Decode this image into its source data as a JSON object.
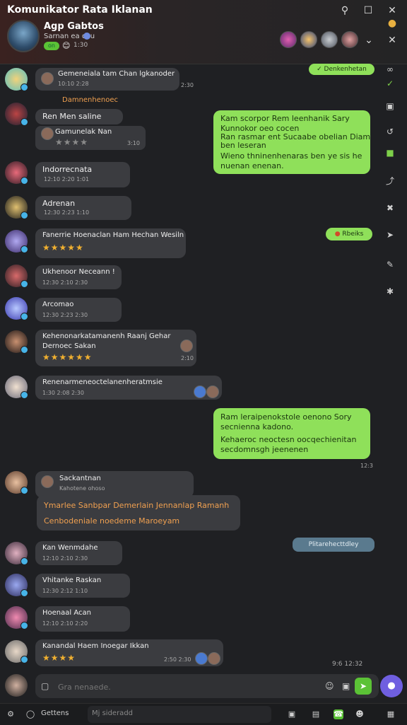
{
  "window": {
    "title": "Komunikator Rata Iklanan"
  },
  "chat": {
    "name": "Agp Gabtos",
    "subtitle": "Sarnan ea dcu",
    "count": "1:30",
    "status_badge": "on"
  },
  "outgoing": {
    "pill_1": "Denkenhetan",
    "msg_1": [
      "Kam scorpor Rem leenhanik Sary",
      "Kunnokor oeo cocen",
      "Ran rasmar ent Sucaabe obelian Diam",
      "ben leseran",
      "Wieno thninenhenaras ben ye sis he",
      "nuenan enenan."
    ],
    "pill_2": "Rbeiks",
    "msg_2": [
      "Ram leraipenokstole oenono Sory",
      "secnienna kadono.",
      "Kehaeroc neoctesn oocqechienitan",
      "secdomnsgh jeenenen"
    ],
    "msg_2_time": "12:3",
    "pill_3": "Plitarehecttdley",
    "last_time": "9:6  12:32"
  },
  "messages": [
    {
      "quote_name": "Gemeneiala tam Chan lgkanoder",
      "quote_meta": "10:10 2:28",
      "time": "2:30",
      "extra": "Damnenhenoec"
    },
    {
      "name": "Ren Men saline",
      "quote_name": "Gamunelak Nan",
      "quote_meta": "2:30",
      "stars": "★★★★",
      "time": "3:10"
    },
    {
      "name": "Indorrecnata",
      "meta": "12:10 2:20  1:01"
    },
    {
      "name": "Adrenan",
      "meta": "12:30 2:23  1:10"
    },
    {
      "name": "Fanerrie Hoenaclan Ham Hechan Wesiln",
      "stars": "★★★★★"
    },
    {
      "name": "Ukhenoor Neceann !",
      "meta": "12:30 2:10 2:30"
    },
    {
      "name": "Arcomao",
      "meta": "12:30 2:23  2:30"
    },
    {
      "name": "Kehenonarkatamanenh Raanj Gehar",
      "name2": "Dernoec Sakan",
      "stars": "★★★★★★",
      "time": "2:10"
    },
    {
      "name": "Renenarmeneoctelanenheratmsie",
      "meta": "1:30 2:08 2:30"
    },
    {
      "name": "Sackantnan",
      "meta": "Kahotene ohoso",
      "orange_1": "Ymarlee Sanbpar Demerlain Jennanlap Ramanh",
      "orange_2": "Cenbodeniale noedeme Maroeyam"
    },
    {
      "name": "Kan Wenmdahe",
      "meta": "12:10 2:10 2:30"
    },
    {
      "name": "Vhitanke Raskan",
      "meta": "12:30 2:12  1:10"
    },
    {
      "name": "Hoenaal Acan",
      "meta": "12:10 2:10  2:20"
    },
    {
      "name": "Kanandal Haem Inoegar Ikkan",
      "stars": "★★★★",
      "time": "2:50 2:30"
    }
  ],
  "composer": {
    "placeholder": "Gra nenaede."
  },
  "bottom": {
    "label": "Gettens",
    "search": "Mj sideradd"
  }
}
